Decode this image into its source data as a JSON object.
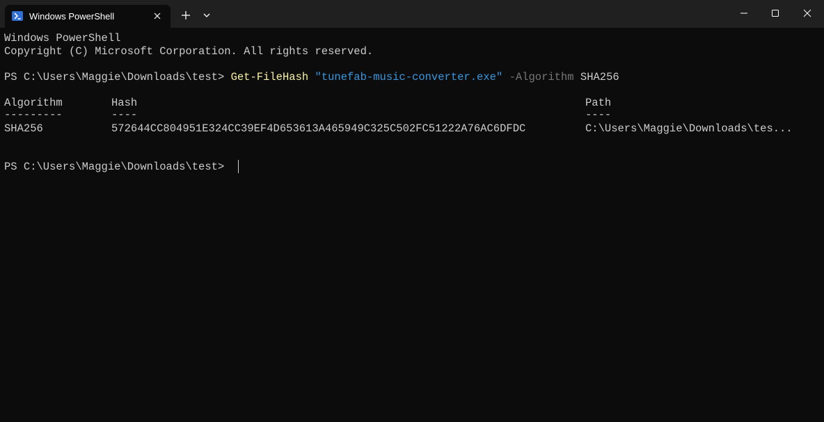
{
  "window": {
    "tab_title": "Windows PowerShell",
    "tab_icon": "powershell-icon",
    "controls": {
      "new_tab": "plus-icon",
      "dropdown": "chevron-down-icon",
      "minimize": "minimize-icon",
      "maximize": "maximize-icon",
      "close": "close-icon"
    }
  },
  "terminal": {
    "banner_line1": "Windows PowerShell",
    "banner_line2": "Copyright (C) Microsoft Corporation. All rights reserved.",
    "prompt1": "PS C:\\Users\\Maggie\\Downloads\\test> ",
    "command_name": "Get-FileHash",
    "command_arg": "\"tunefab-music-converter.exe\"",
    "command_param": "-Algorithm",
    "command_param_value": "SHA256",
    "table": {
      "headers": [
        "Algorithm",
        "Hash",
        "Path"
      ],
      "underlines": [
        "---------",
        "----",
        "----"
      ],
      "rows": [
        [
          "SHA256",
          "572644CC804951E324CC39EF4D653613A465949C325C502FC51222A76AC6DFDC",
          "C:\\Users\\Maggie\\Downloads\\tes..."
        ]
      ]
    },
    "prompt2": "PS C:\\Users\\Maggie\\Downloads\\test> "
  },
  "colors": {
    "background": "#0c0c0c",
    "titlebar": "#202020",
    "text": "#cccccc",
    "command": "#f9f1a5",
    "string": "#3a96dd",
    "parameter": "#767676"
  }
}
